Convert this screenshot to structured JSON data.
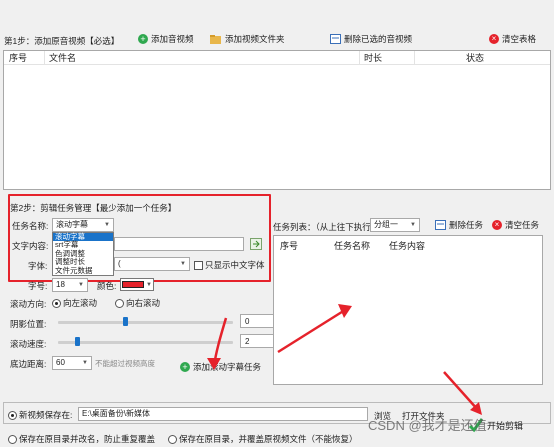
{
  "step1": {
    "title": "第1步：添加原音视频【必选】",
    "add_audio_video": "添加音视频",
    "add_video_folder": "添加视频文件夹",
    "delete_selected": "删除已选的音视频",
    "clear_table": "清空表格",
    "columns": [
      "序号",
      "文件名",
      "时长",
      "状态"
    ]
  },
  "step2": {
    "title": "第2步：剪辑任务管理【最少添加一个任务】",
    "task_name_label": "任务名称:",
    "task_name_value": "滚动字幕",
    "task_options": [
      "滚动字幕",
      "srt字幕",
      "色调调整",
      "调整时长",
      "文件元数据"
    ],
    "text_content_label": "文字内容:",
    "font_label": "字体:",
    "font_value": "(",
    "only_chinese_font": "只显示中文字体",
    "font_size_label": "字号:",
    "font_size_value": "18",
    "color_label": "颜色:",
    "scroll_dir_label": "滚动方向:",
    "scroll_left": "向左滚动",
    "scroll_right": "向右滚动",
    "shadow_pos_label": "阴影位置:",
    "shadow_value": "0",
    "shadow_level": 0.38,
    "scroll_speed_label": "滚动速度:",
    "speed_value": "2",
    "speed_level": 0.1,
    "bottom_dist_label": "底边距离:",
    "bottom_dist_value": "60",
    "bottom_hint": "不能超过视频高度",
    "add_scroll_task": "添加滚动字幕任务"
  },
  "tasks": {
    "list_label": "任务列表：（从上往下执行）",
    "group_value": "分组一",
    "delete_task": "删除任务",
    "clear_task": "清空任务",
    "columns": [
      "序号",
      "任务名称",
      "任务内容"
    ]
  },
  "output": {
    "save_to_label": "新视频保存在:",
    "save_path": "E:\\桌面备份\\新媒体",
    "browse": "浏览",
    "open_folder": "打开文件夹",
    "save_in_original_rename": "保存在原目录并改名，防止重复覆盖",
    "save_in_original_overwrite": "保存在原目录，并覆盖原视频文件（不能恢复）",
    "start_clip": "开始剪辑"
  },
  "watermark": "CSDN @我才是还值",
  "colors": {
    "accent_red": "#e5222b",
    "green": "#2fa84f",
    "blue": "#1a73c9"
  }
}
